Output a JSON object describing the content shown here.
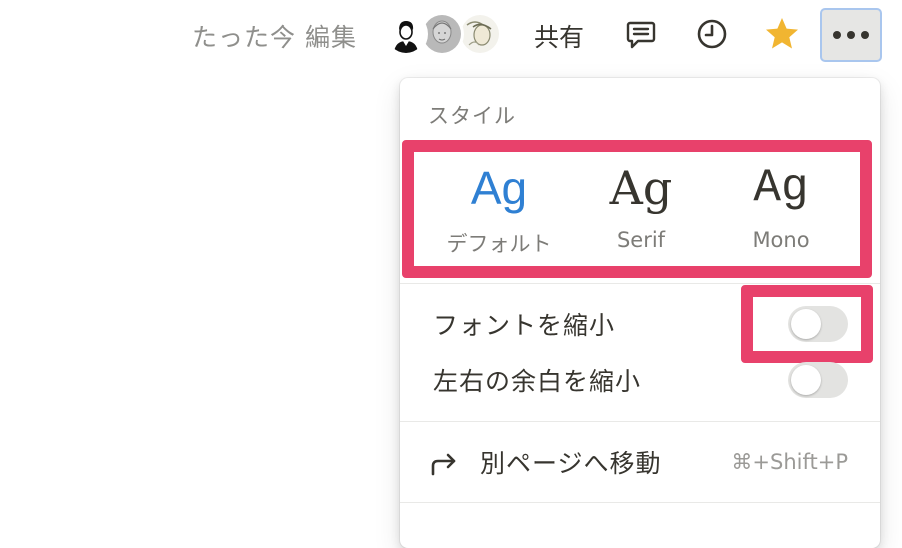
{
  "topbar": {
    "edited_status": "たった今 編集",
    "avatars": [
      "user-avatar-1",
      "user-avatar-2",
      "user-avatar-3"
    ],
    "share_label": "共有",
    "icons": [
      "comment-icon",
      "clock-icon",
      "star-icon",
      "more-icon"
    ],
    "star_color": "#f1b531",
    "more_button_active_border": "#a9c6ee"
  },
  "menu": {
    "style_section_label": "スタイル",
    "styles": [
      {
        "sample": "Ag",
        "caption": "デフォルト",
        "selected": true,
        "color": "#2f80d3"
      },
      {
        "sample": "Ag",
        "caption": "Serif",
        "selected": false
      },
      {
        "sample": "Ag",
        "caption": "Mono",
        "selected": false
      }
    ],
    "toggles": [
      {
        "label": "フォントを縮小",
        "on": false
      },
      {
        "label": "左右の余白を縮小",
        "on": false
      }
    ],
    "move_item": {
      "label": "別ページへ移動",
      "shortcut": "⌘+Shift+P",
      "icon": "redirect-arrow-icon"
    },
    "highlight_color": "#e8416b"
  }
}
